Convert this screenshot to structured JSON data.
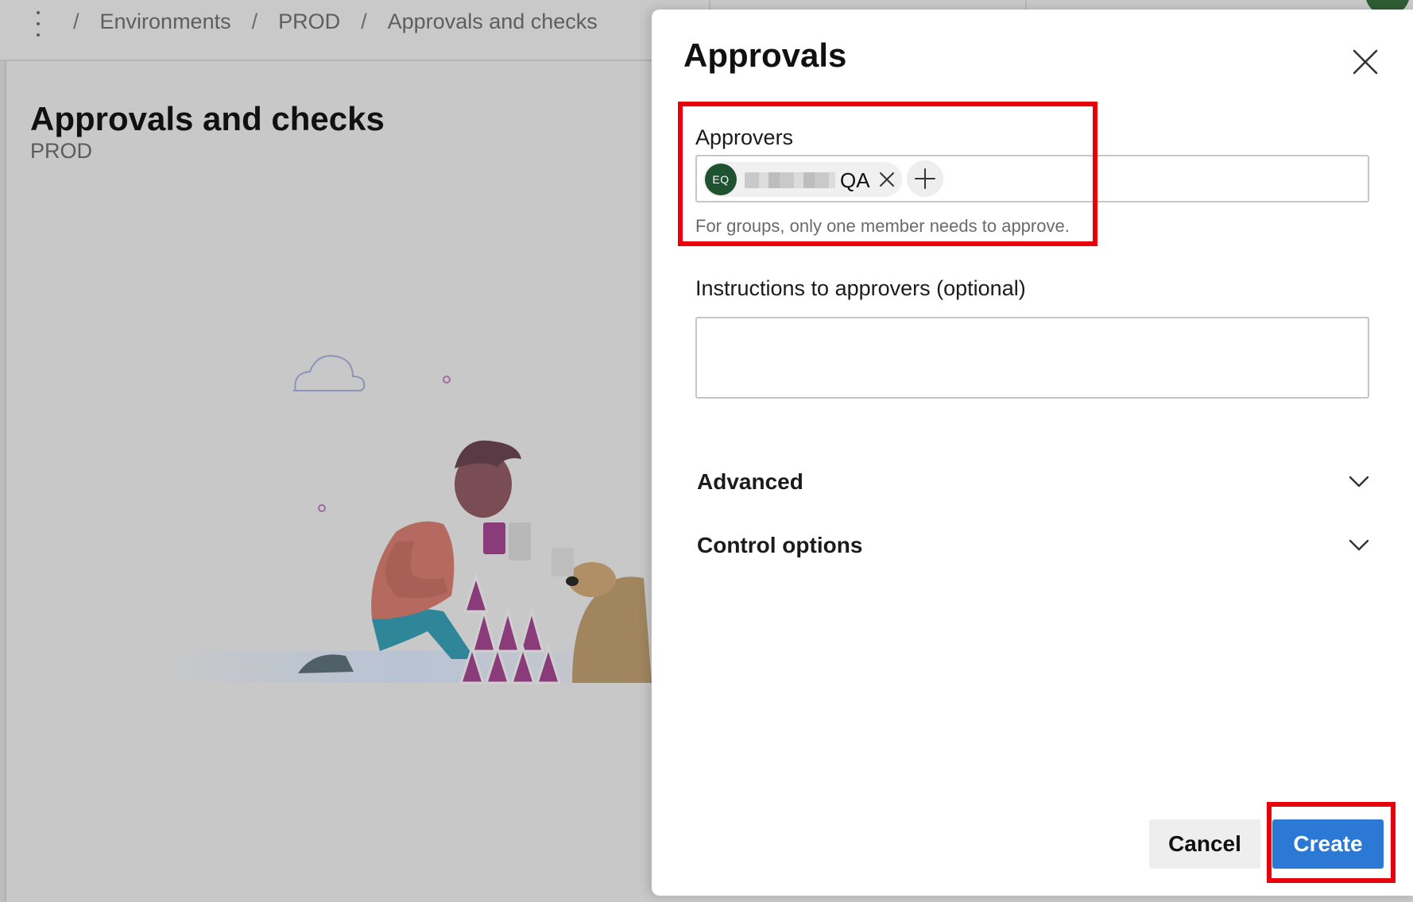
{
  "topbar": {
    "breadcrumbs": [
      "Environments",
      "PROD",
      "Approvals and checks"
    ],
    "separator": "/"
  },
  "page": {
    "title": "Approvals and checks",
    "subtitle": "PROD"
  },
  "panel": {
    "title": "Approvals",
    "approvers": {
      "label": "Approvers",
      "selected": [
        {
          "initials": "EQ",
          "name": "QA",
          "avatar_color": "#1f5230",
          "name_redacted": true
        }
      ],
      "helper": "For groups, only one member needs to approve."
    },
    "instructions": {
      "label": "Instructions to approvers (optional)",
      "value": ""
    },
    "sections": [
      {
        "label": "Advanced",
        "expanded": false
      },
      {
        "label": "Control options",
        "expanded": false
      }
    ],
    "buttons": {
      "cancel": "Cancel",
      "create": "Create"
    }
  },
  "colors": {
    "primary": "#2b79d4",
    "highlight": "#e8000b",
    "overlay": "#c8c8c8"
  }
}
